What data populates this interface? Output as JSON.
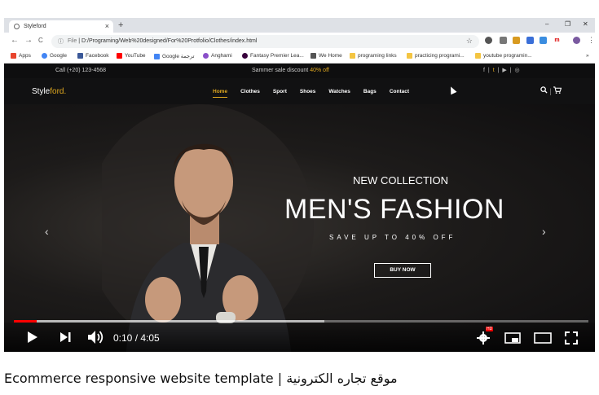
{
  "browser": {
    "tab_title": "Styleford",
    "tab_close": "×",
    "new_tab": "+",
    "win_minimize": "–",
    "win_restore": "❐",
    "win_close": "✕",
    "back": "←",
    "forward": "→",
    "reload": "C",
    "url_prefix": "File",
    "url": "D:/Programing/Web%20designed/For%20Protfolio/Clothes/index.html",
    "star": "☆",
    "bookmarks": [
      "Apps",
      "Google",
      "Facebook",
      "YouTube",
      "Google ترجمة",
      "Anghami",
      "Fantasy Premier Lea...",
      "We Home",
      "programing links",
      "practicing programi...",
      "youtube programin..."
    ],
    "more": "»"
  },
  "site": {
    "call": "Call  (+20) 123-4568",
    "sale_text": "Sammer sale discount",
    "sale_pct": "40% off",
    "social": {
      "facebook": "f",
      "twitter": "t",
      "youtube": "▶",
      "instagram": "◎",
      "sep": "|"
    },
    "brand_style": "Style",
    "brand_ford": "ford.",
    "menu": [
      "Home",
      "Clothes",
      "Sport",
      "Shoes",
      "Watches",
      "Bags",
      "Contact"
    ],
    "search_icon": "search-icon",
    "cart_icon": "cart-icon",
    "hero_kicker": "NEW COLLECTION",
    "hero_headline": "MEN'S FASHION",
    "hero_sub": "SAVE UP TO 40% OFF",
    "hero_button": "BUY NOW",
    "prev": "‹",
    "next": "›"
  },
  "player": {
    "time": "0:10 / 4:05",
    "progress": 0.04,
    "buffered": 0.54,
    "hd_badge": "HD"
  },
  "video_title": "Ecommerce responsive website template | موقع تجاره الكترونية"
}
